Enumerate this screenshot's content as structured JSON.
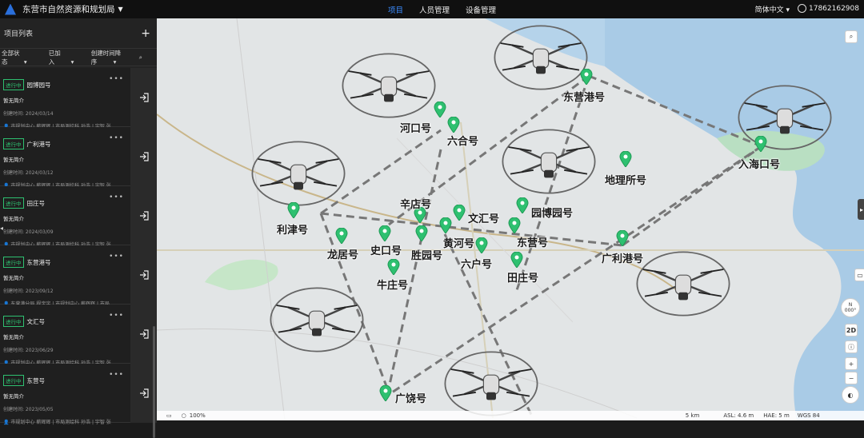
{
  "app": {
    "title": "东营市自然资源和规划局"
  },
  "nav": {
    "items": [
      "项目",
      "人员管理",
      "设备管理"
    ],
    "active": "项目"
  },
  "topright": {
    "language": "简体中文",
    "phone": "17862162908"
  },
  "sidebar": {
    "heading": "项目列表",
    "filters": {
      "status": "全部状态",
      "joined": "已加入",
      "sort": "创建时间降序"
    },
    "projects": [
      {
        "badge": "进行中",
        "name": "园博园号",
        "desc": "暂无简介",
        "created": "创建时间: 2024/03/14",
        "members": "市规划中心 薪辉辉 | 市局测绘科 孙浩 | 宇智 张"
      },
      {
        "badge": "进行中",
        "name": "广利港号",
        "desc": "暂无简介",
        "created": "创建时间: 2024/03/12",
        "members": "市规划中心 薪辉辉 | 市局测绘科 孙浩 | 宇智 张"
      },
      {
        "badge": "进行中",
        "name": "田庄号",
        "desc": "暂无简介",
        "created": "创建时间: 2024/03/09",
        "members": "市规划中心 薪辉辉 | 市局测绘科 孙浩 | 宇智 张"
      },
      {
        "badge": "进行中",
        "name": "东营港号",
        "desc": "暂无简介",
        "created": "创建时间: 2023/09/12",
        "members": "东营港分局 程宝宇 | 市规划中心 薪辉辉 | 市局"
      },
      {
        "badge": "进行中",
        "name": "文汇号",
        "desc": "暂无简介",
        "created": "创建时间: 2023/06/29",
        "members": "市规划中心 薪辉辉 | 市局测绘科 孙浩 | 宇智 张"
      },
      {
        "badge": "进行中",
        "name": "东营号",
        "desc": "暂无简介",
        "created": "创建时间: 2023/05/05",
        "members": "市规划中心 薪辉辉 | 市局测绘科 孙浩 | 宇智 张"
      }
    ]
  },
  "map": {
    "points": [
      {
        "name": "东营港号"
      },
      {
        "name": "河口号"
      },
      {
        "name": "六合号"
      },
      {
        "name": "入海口号"
      },
      {
        "name": "地理所号"
      },
      {
        "name": "辛店号"
      },
      {
        "name": "文汇号"
      },
      {
        "name": "园博园号"
      },
      {
        "name": "利津号"
      },
      {
        "name": "黄河号"
      },
      {
        "name": "东营号"
      },
      {
        "name": "广利港号"
      },
      {
        "name": "龙居号"
      },
      {
        "name": "史口号"
      },
      {
        "name": "胜园号"
      },
      {
        "name": "六户号"
      },
      {
        "name": "田庄号"
      },
      {
        "name": "牛庄号"
      },
      {
        "name": "广饶号"
      }
    ],
    "controls": {
      "view_mode": "2D",
      "compass": "N",
      "compass_value": "000°"
    },
    "status": {
      "zoom": "100%",
      "scale": "5 km",
      "asl": "ASL: 4.6 m",
      "hae": "HAE: 5 m",
      "crs": "WGS 84"
    }
  }
}
